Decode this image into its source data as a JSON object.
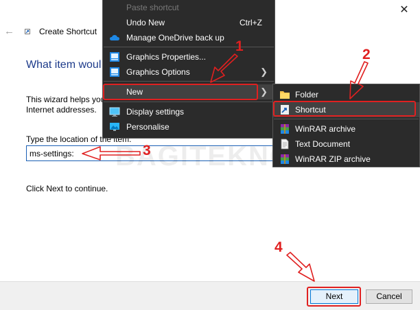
{
  "wizard": {
    "title": "Create Shortcut",
    "close_glyph": "✕",
    "back_glyph": "←",
    "heading": "What item woul",
    "description": "This wizard helps you Internet addresses.",
    "location_label": "Type the location of the item:",
    "location_value": "ms-settings:",
    "footer_text": "Click Next to continue.",
    "next_label": "Next",
    "cancel_label": "Cancel"
  },
  "context_menu": {
    "items": [
      {
        "label": "Paste shortcut",
        "state": "disabled"
      },
      {
        "label": "Undo New",
        "shortcut": "Ctrl+Z"
      },
      {
        "label": "Manage OneDrive back up",
        "icon": "onedrive-icon"
      },
      {
        "label": "Graphics Properties...",
        "icon": "graphics-icon"
      },
      {
        "label": "Graphics Options",
        "icon": "graphics-icon",
        "submenu": true
      },
      {
        "label": "New",
        "submenu": true,
        "state": "highlighted"
      },
      {
        "label": "Display settings",
        "icon": "display-icon"
      },
      {
        "label": "Personalise",
        "icon": "personalise-icon"
      }
    ],
    "submenu_arrow": "❯"
  },
  "new_submenu": {
    "items": [
      {
        "label": "Folder",
        "icon": "folder-icon"
      },
      {
        "label": "Shortcut",
        "icon": "shortcut-icon",
        "state": "highlighted"
      },
      {
        "label": "WinRAR archive",
        "icon": "winrar-icon"
      },
      {
        "label": "Text Document",
        "icon": "text-document-icon"
      },
      {
        "label": "WinRAR ZIP archive",
        "icon": "winrar-zip-icon"
      }
    ]
  },
  "annotations": {
    "step_1": "1",
    "step_2": "2",
    "step_3": "3",
    "step_4": "4",
    "color": "#e02020"
  },
  "watermark": "BAGITEKNO",
  "colors": {
    "menu_bg": "#2b2b2b",
    "menu_highlight": "#414141",
    "heading": "#1c3a8a",
    "input_border": "#1a5fb4"
  }
}
